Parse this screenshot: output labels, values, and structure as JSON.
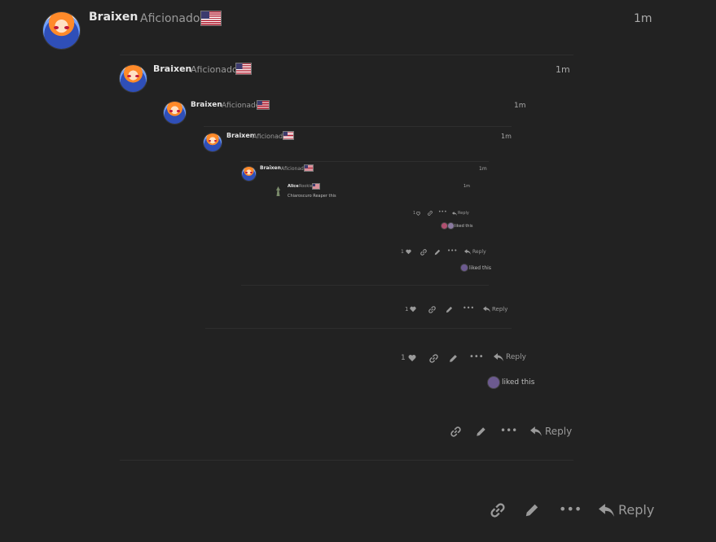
{
  "user": {
    "name": "Braixen",
    "title": "Aficionado",
    "time": "1m"
  },
  "alice": {
    "name": "Alice",
    "title": "Rookie",
    "time": "1m",
    "body": "Chiaroscuro Reaper this"
  },
  "actions": {
    "reply": "Reply",
    "like_count": "1",
    "liked_suffix": "liked this"
  },
  "colors": {
    "background": "#222222",
    "text": "#cfcfcf",
    "muted": "#9a9a9a",
    "flag_red": "#b22234",
    "flag_blue": "#3c3b6e"
  },
  "icons": [
    "link-icon",
    "edit-icon",
    "more-icon",
    "reply-icon",
    "heart-icon",
    "flag-icon"
  ]
}
